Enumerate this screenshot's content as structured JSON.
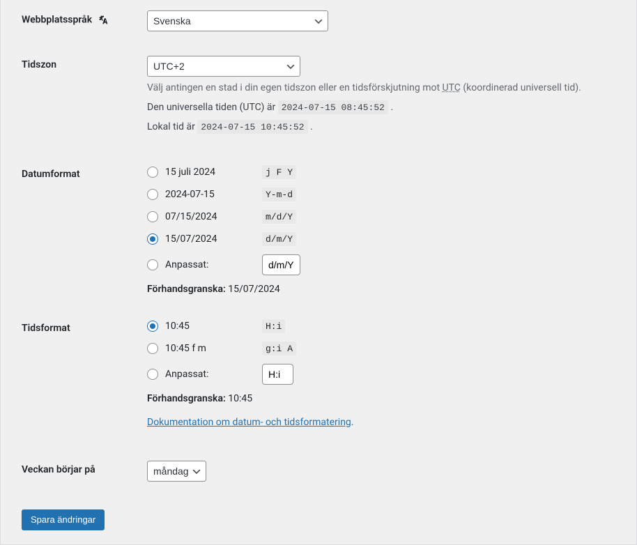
{
  "siteLanguage": {
    "label": "Webbplatsspråk",
    "selected": "Svenska"
  },
  "timezone": {
    "label": "Tidszon",
    "selected": "UTC+2",
    "description_pre": "Välj antingen en stad i din egen tidszon eller en tidsförskjutning mot ",
    "description_abbr": "UTC",
    "description_post": " (koordinerad universell tid).",
    "utc_label": "Den universella tiden (UTC) är ",
    "utc_time": "2024-07-15 08:45:52",
    "local_label": "Lokal tid är ",
    "local_time": "2024-07-15 10:45:52"
  },
  "dateFormat": {
    "label": "Datumformat",
    "options": [
      {
        "example": "15 juli 2024",
        "code": "j F Y",
        "selected": false
      },
      {
        "example": "2024-07-15",
        "code": "Y-m-d",
        "selected": false
      },
      {
        "example": "07/15/2024",
        "code": "m/d/Y",
        "selected": false
      },
      {
        "example": "15/07/2024",
        "code": "d/m/Y",
        "selected": true
      }
    ],
    "custom_label": "Anpassat:",
    "custom_value": "d/m/Y",
    "preview_label": "Förhandsgranska:",
    "preview_value": "15/07/2024"
  },
  "timeFormat": {
    "label": "Tidsformat",
    "options": [
      {
        "example": "10:45",
        "code": "H:i",
        "selected": true
      },
      {
        "example": "10:45 f m",
        "code": "g:i A",
        "selected": false
      }
    ],
    "custom_label": "Anpassat:",
    "custom_value": "H:i",
    "preview_label": "Förhandsgranska:",
    "preview_value": "10:45",
    "doc_link": "Dokumentation om datum- och tidsformatering"
  },
  "weekStart": {
    "label": "Veckan börjar på",
    "selected": "måndag"
  },
  "submit": {
    "label": "Spara ändringar"
  }
}
